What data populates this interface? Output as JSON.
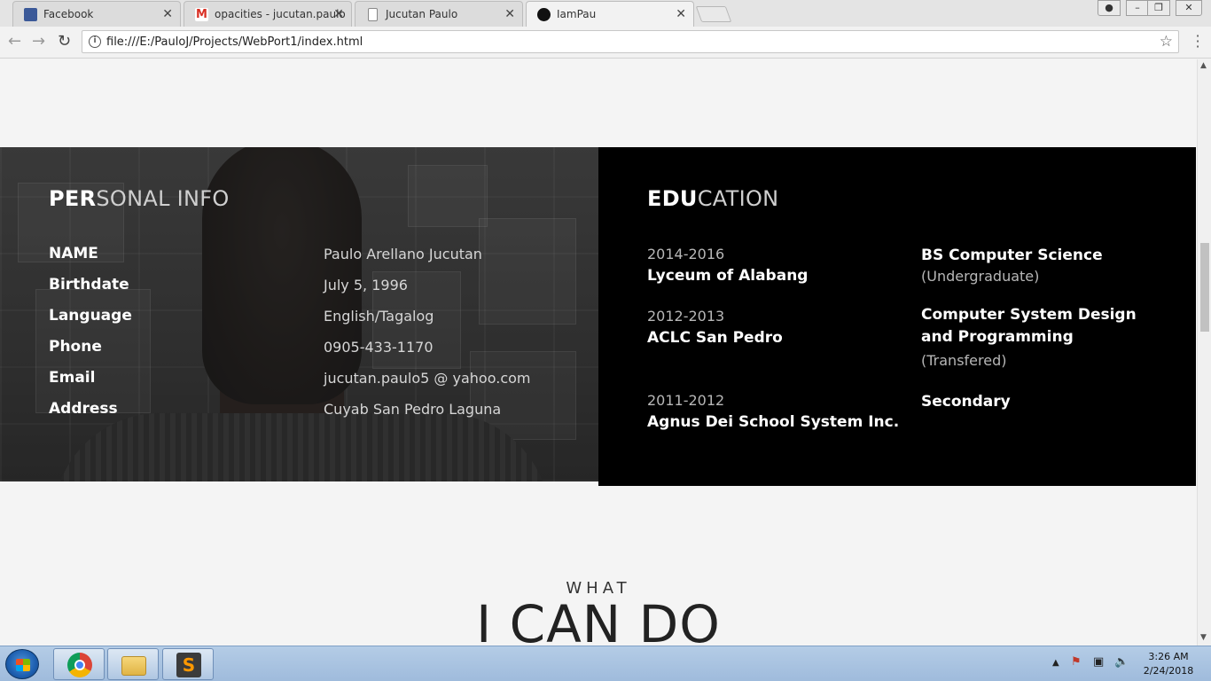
{
  "browser": {
    "tabs": [
      {
        "title": "Facebook",
        "favicon": "facebook-icon",
        "color": "#3b5998"
      },
      {
        "title": "opacities - jucutan.paulo",
        "favicon": "gmail-icon",
        "color": "#d93025"
      },
      {
        "title": "Jucutan Paulo",
        "favicon": "document-icon",
        "color": "#777777"
      },
      {
        "title": "IamPau",
        "favicon": "pinterest-icon",
        "color": "#111111"
      }
    ],
    "url": "file:///E:/PauloJ/Projects/WebPort1/index.html"
  },
  "personal": {
    "title_bold": "PER",
    "title_light": "SONAL INFO",
    "rows": [
      {
        "label": "NAME",
        "value": "Paulo Arellano Jucutan"
      },
      {
        "label": "Birthdate",
        "value": "July 5, 1996"
      },
      {
        "label": "Language",
        "value": "English/Tagalog"
      },
      {
        "label": "Phone",
        "value": "0905-433-1170"
      },
      {
        "label": "Email",
        "value": "jucutan.paulo5 @ yahoo.com"
      },
      {
        "label": "Address",
        "value": "Cuyab San Pedro Laguna"
      }
    ]
  },
  "education": {
    "title_bold": "EDU",
    "title_light": "CATION",
    "entries": [
      {
        "years": "2014-2016",
        "school": "Lyceum of Alabang",
        "course": "BS Computer Science",
        "note": "(Undergraduate)"
      },
      {
        "years": "2012-2013",
        "school": "ACLC San Pedro",
        "course": "Computer System Design and Programming",
        "note": "(Transfered)"
      },
      {
        "years": "2011-2012",
        "school": "Agnus Dei School System Inc.",
        "course": "Secondary",
        "note": ""
      }
    ]
  },
  "skills": {
    "kicker": "WHAT",
    "heading": "I CAN DO"
  },
  "taskbar": {
    "apps": [
      "chrome-icon",
      "file-explorer-icon",
      "sublime-text-icon"
    ],
    "time": "3:26 AM",
    "date": "2/24/2018"
  }
}
